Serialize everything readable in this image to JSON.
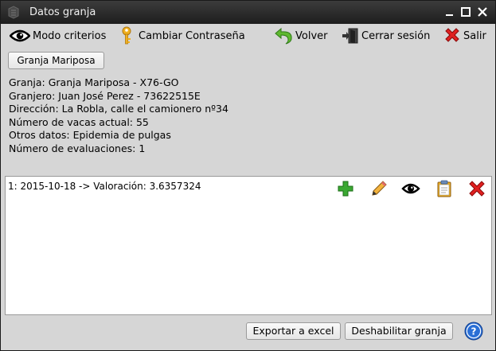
{
  "window": {
    "title": "Datos granja"
  },
  "toolbar": {
    "criteria_label": "Modo criterios",
    "password_label": "Cambiar Contraseña",
    "back_label": "Volver",
    "logout_label": "Cerrar sesión",
    "exit_label": "Salir"
  },
  "farm_button_label": "Granja Mariposa",
  "info": {
    "granja": "Granja: Granja Mariposa - X76-GO",
    "granjero": "Granjero: Juan José Perez - 73622515E",
    "direccion": "Dirección: La Robla, calle el camionero nº34",
    "vacas": "Número de vacas actual: 55",
    "otros": "Otros datos: Epidemia de pulgas",
    "evaluaciones": "Número de evaluaciones: 1"
  },
  "evaluations": [
    {
      "text": "1: 2015-10-18 -> Valoración: 3.6357324"
    }
  ],
  "row_actions": [
    "add-icon",
    "edit-pencil-icon",
    "view-eye-icon",
    "clipboard-icon",
    "delete-icon"
  ],
  "footer": {
    "export_label": "Exportar a excel",
    "disable_label": "Deshabilitar granja"
  },
  "colors": {
    "titlebar": "#2a2a2a",
    "window_bg": "#d6d6d6",
    "add_green": "#3aa832",
    "delete_red": "#e02020",
    "help_blue": "#2a6fd6"
  }
}
